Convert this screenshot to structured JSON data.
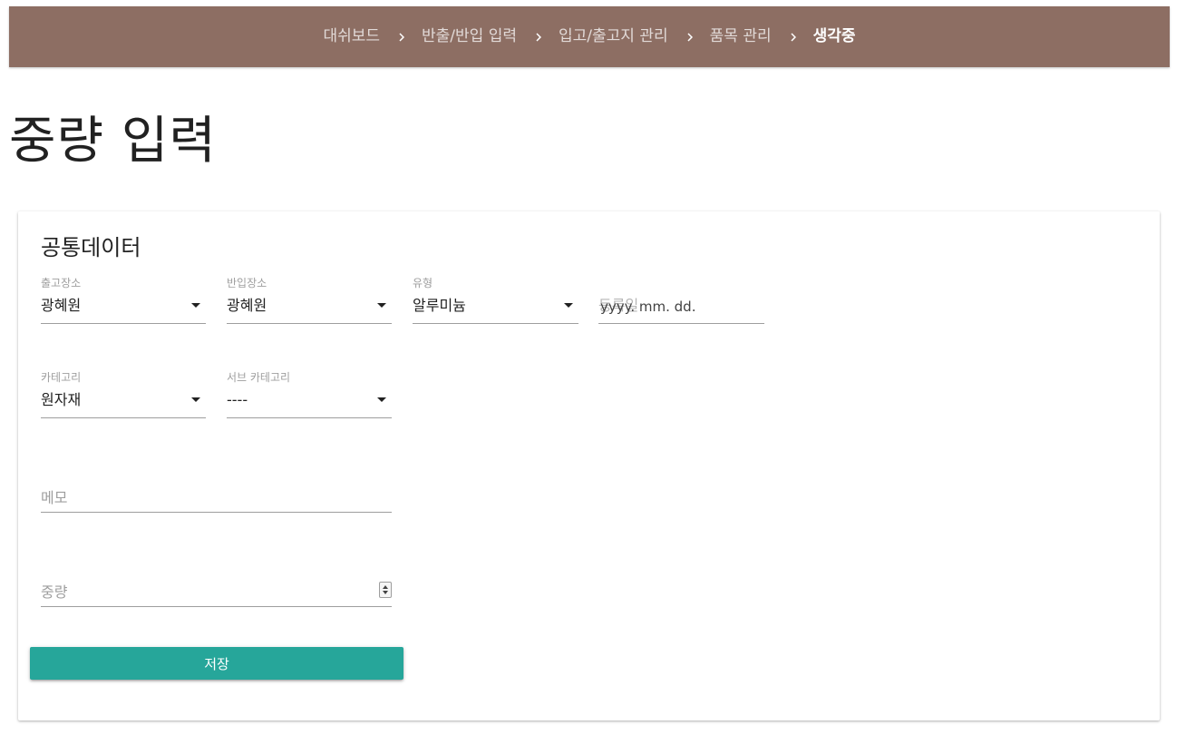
{
  "breadcrumb": {
    "items": [
      {
        "label": "대쉬보드"
      },
      {
        "label": "반출/반입 입력"
      },
      {
        "label": "입고/출고지 관리"
      },
      {
        "label": "품목 관리"
      },
      {
        "label": "생각중"
      }
    ],
    "separator_icon": "chevron-right-icon"
  },
  "page": {
    "title": "중량 입력"
  },
  "form": {
    "section_title": "공통데이터",
    "fields": {
      "out_place": {
        "label": "출고장소",
        "value": "광혜원"
      },
      "in_place": {
        "label": "반입장소",
        "value": "광혜원"
      },
      "type": {
        "label": "유형",
        "value": "알루미늄"
      },
      "date": {
        "label": "등록일",
        "value": "yyyy. mm. dd."
      },
      "category": {
        "label": "카테고리",
        "value": "원자재"
      },
      "sub_category": {
        "label": "서브 카테고리",
        "value": "----"
      },
      "memo": {
        "placeholder": "메모"
      },
      "weight": {
        "placeholder": "중량"
      }
    },
    "save_label": "저장"
  },
  "colors": {
    "topbar": "#8d6e63",
    "save_button": "#26a69a",
    "underline": "#9e9e9e"
  }
}
